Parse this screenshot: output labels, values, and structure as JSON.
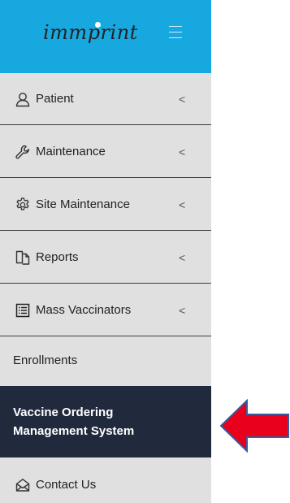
{
  "header": {
    "logo_text": "immprint",
    "menu_toggle_icon": "hamburger-icon",
    "background": "#17a8e0"
  },
  "menu": [
    {
      "label": "Patient",
      "icon": "user-icon",
      "expand_icon": "chevron-left-icon"
    },
    {
      "label": "Maintenance",
      "icon": "wrench-icon",
      "expand_icon": "chevron-left-icon"
    },
    {
      "label": "Site Maintenance",
      "icon": "gear-icon",
      "expand_icon": "chevron-left-icon"
    },
    {
      "label": "Reports",
      "icon": "documents-icon",
      "expand_icon": "chevron-left-icon"
    },
    {
      "label": "Mass Vaccinators",
      "icon": "list-icon",
      "expand_icon": "chevron-left-icon"
    }
  ],
  "enrollments": {
    "label": "Enrollments"
  },
  "active_item": {
    "line1": "Vaccine Ordering",
    "line2": "Management System",
    "background": "#212a3c"
  },
  "contact": {
    "label": "Contact Us",
    "icon": "envelope-open-icon"
  },
  "chevron_glyph": "<",
  "annotation": {
    "icon": "red-arrow-left-icon",
    "color": "#e8001c"
  }
}
